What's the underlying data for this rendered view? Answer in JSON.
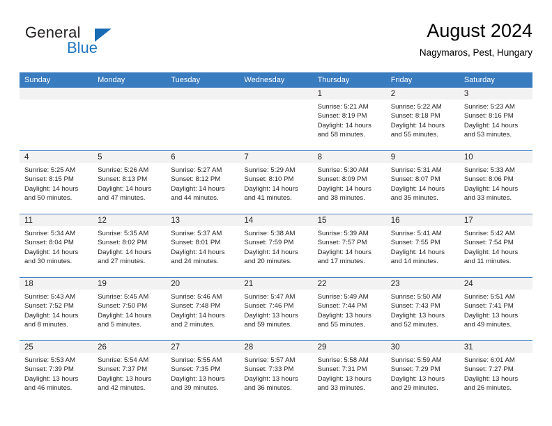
{
  "brand": {
    "name_part1": "General",
    "name_part2": "Blue",
    "accent_color": "#176bb3"
  },
  "header": {
    "title": "August 2024",
    "location": "Nagymaros, Pest, Hungary"
  },
  "theme": {
    "header_row_bg": "#3a7cc0",
    "daynum_bg": "#f2f2f2",
    "text_color": "#231f20"
  },
  "weekday_headers": [
    "Sunday",
    "Monday",
    "Tuesday",
    "Wednesday",
    "Thursday",
    "Friday",
    "Saturday"
  ],
  "weeks": [
    [
      {
        "day": "",
        "sunrise": "",
        "sunset": "",
        "daylight": "",
        "blank": true
      },
      {
        "day": "",
        "sunrise": "",
        "sunset": "",
        "daylight": "",
        "blank": true
      },
      {
        "day": "",
        "sunrise": "",
        "sunset": "",
        "daylight": "",
        "blank": true
      },
      {
        "day": "",
        "sunrise": "",
        "sunset": "",
        "daylight": "",
        "blank": true
      },
      {
        "day": "1",
        "sunrise": "Sunrise: 5:21 AM",
        "sunset": "Sunset: 8:19 PM",
        "daylight": "Daylight: 14 hours and 58 minutes."
      },
      {
        "day": "2",
        "sunrise": "Sunrise: 5:22 AM",
        "sunset": "Sunset: 8:18 PM",
        "daylight": "Daylight: 14 hours and 55 minutes."
      },
      {
        "day": "3",
        "sunrise": "Sunrise: 5:23 AM",
        "sunset": "Sunset: 8:16 PM",
        "daylight": "Daylight: 14 hours and 53 minutes."
      }
    ],
    [
      {
        "day": "4",
        "sunrise": "Sunrise: 5:25 AM",
        "sunset": "Sunset: 8:15 PM",
        "daylight": "Daylight: 14 hours and 50 minutes."
      },
      {
        "day": "5",
        "sunrise": "Sunrise: 5:26 AM",
        "sunset": "Sunset: 8:13 PM",
        "daylight": "Daylight: 14 hours and 47 minutes."
      },
      {
        "day": "6",
        "sunrise": "Sunrise: 5:27 AM",
        "sunset": "Sunset: 8:12 PM",
        "daylight": "Daylight: 14 hours and 44 minutes."
      },
      {
        "day": "7",
        "sunrise": "Sunrise: 5:29 AM",
        "sunset": "Sunset: 8:10 PM",
        "daylight": "Daylight: 14 hours and 41 minutes."
      },
      {
        "day": "8",
        "sunrise": "Sunrise: 5:30 AM",
        "sunset": "Sunset: 8:09 PM",
        "daylight": "Daylight: 14 hours and 38 minutes."
      },
      {
        "day": "9",
        "sunrise": "Sunrise: 5:31 AM",
        "sunset": "Sunset: 8:07 PM",
        "daylight": "Daylight: 14 hours and 35 minutes."
      },
      {
        "day": "10",
        "sunrise": "Sunrise: 5:33 AM",
        "sunset": "Sunset: 8:06 PM",
        "daylight": "Daylight: 14 hours and 33 minutes."
      }
    ],
    [
      {
        "day": "11",
        "sunrise": "Sunrise: 5:34 AM",
        "sunset": "Sunset: 8:04 PM",
        "daylight": "Daylight: 14 hours and 30 minutes."
      },
      {
        "day": "12",
        "sunrise": "Sunrise: 5:35 AM",
        "sunset": "Sunset: 8:02 PM",
        "daylight": "Daylight: 14 hours and 27 minutes."
      },
      {
        "day": "13",
        "sunrise": "Sunrise: 5:37 AM",
        "sunset": "Sunset: 8:01 PM",
        "daylight": "Daylight: 14 hours and 24 minutes."
      },
      {
        "day": "14",
        "sunrise": "Sunrise: 5:38 AM",
        "sunset": "Sunset: 7:59 PM",
        "daylight": "Daylight: 14 hours and 20 minutes."
      },
      {
        "day": "15",
        "sunrise": "Sunrise: 5:39 AM",
        "sunset": "Sunset: 7:57 PM",
        "daylight": "Daylight: 14 hours and 17 minutes."
      },
      {
        "day": "16",
        "sunrise": "Sunrise: 5:41 AM",
        "sunset": "Sunset: 7:55 PM",
        "daylight": "Daylight: 14 hours and 14 minutes."
      },
      {
        "day": "17",
        "sunrise": "Sunrise: 5:42 AM",
        "sunset": "Sunset: 7:54 PM",
        "daylight": "Daylight: 14 hours and 11 minutes."
      }
    ],
    [
      {
        "day": "18",
        "sunrise": "Sunrise: 5:43 AM",
        "sunset": "Sunset: 7:52 PM",
        "daylight": "Daylight: 14 hours and 8 minutes."
      },
      {
        "day": "19",
        "sunrise": "Sunrise: 5:45 AM",
        "sunset": "Sunset: 7:50 PM",
        "daylight": "Daylight: 14 hours and 5 minutes."
      },
      {
        "day": "20",
        "sunrise": "Sunrise: 5:46 AM",
        "sunset": "Sunset: 7:48 PM",
        "daylight": "Daylight: 14 hours and 2 minutes."
      },
      {
        "day": "21",
        "sunrise": "Sunrise: 5:47 AM",
        "sunset": "Sunset: 7:46 PM",
        "daylight": "Daylight: 13 hours and 59 minutes."
      },
      {
        "day": "22",
        "sunrise": "Sunrise: 5:49 AM",
        "sunset": "Sunset: 7:44 PM",
        "daylight": "Daylight: 13 hours and 55 minutes."
      },
      {
        "day": "23",
        "sunrise": "Sunrise: 5:50 AM",
        "sunset": "Sunset: 7:43 PM",
        "daylight": "Daylight: 13 hours and 52 minutes."
      },
      {
        "day": "24",
        "sunrise": "Sunrise: 5:51 AM",
        "sunset": "Sunset: 7:41 PM",
        "daylight": "Daylight: 13 hours and 49 minutes."
      }
    ],
    [
      {
        "day": "25",
        "sunrise": "Sunrise: 5:53 AM",
        "sunset": "Sunset: 7:39 PM",
        "daylight": "Daylight: 13 hours and 46 minutes."
      },
      {
        "day": "26",
        "sunrise": "Sunrise: 5:54 AM",
        "sunset": "Sunset: 7:37 PM",
        "daylight": "Daylight: 13 hours and 42 minutes."
      },
      {
        "day": "27",
        "sunrise": "Sunrise: 5:55 AM",
        "sunset": "Sunset: 7:35 PM",
        "daylight": "Daylight: 13 hours and 39 minutes."
      },
      {
        "day": "28",
        "sunrise": "Sunrise: 5:57 AM",
        "sunset": "Sunset: 7:33 PM",
        "daylight": "Daylight: 13 hours and 36 minutes."
      },
      {
        "day": "29",
        "sunrise": "Sunrise: 5:58 AM",
        "sunset": "Sunset: 7:31 PM",
        "daylight": "Daylight: 13 hours and 33 minutes."
      },
      {
        "day": "30",
        "sunrise": "Sunrise: 5:59 AM",
        "sunset": "Sunset: 7:29 PM",
        "daylight": "Daylight: 13 hours and 29 minutes."
      },
      {
        "day": "31",
        "sunrise": "Sunrise: 6:01 AM",
        "sunset": "Sunset: 7:27 PM",
        "daylight": "Daylight: 13 hours and 26 minutes."
      }
    ]
  ]
}
